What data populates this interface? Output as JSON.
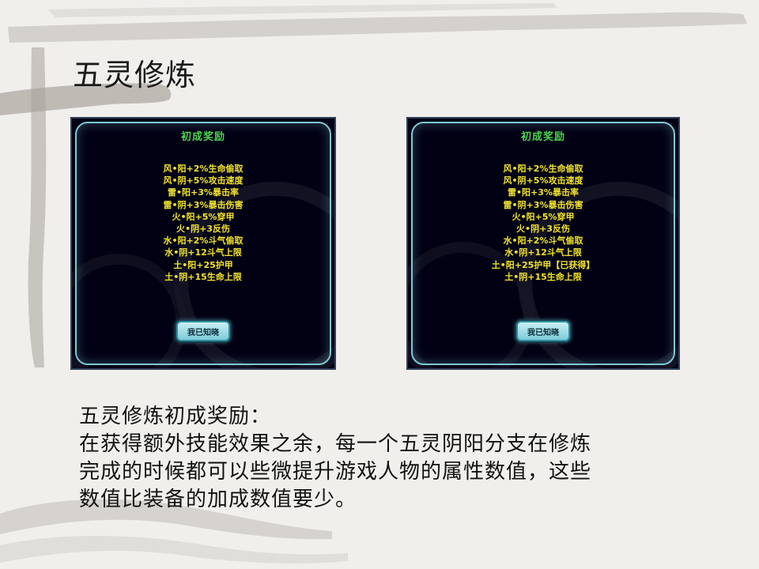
{
  "slide": {
    "title": "五灵修炼"
  },
  "panels": [
    {
      "header": "初成奖励",
      "items": [
        "风•阳+2%生命偷取",
        "风•阴+5%攻击速度",
        "雷•阳+3%暴击率",
        "雷•阴+3%暴击伤害",
        "火•阳+5%穿甲",
        "火•阴+3反伤",
        "水•阳+2%斗气偷取",
        "水•阴+12斗气上限",
        "土•阳+25护甲",
        "土•阴+15生命上限"
      ],
      "button": "我已知晓"
    },
    {
      "header": "初成奖励",
      "items": [
        "风•阳+2%生命偷取",
        "风•阴+5%攻击速度",
        "雷•阳+3%暴击率",
        "雷•阴+3%暴击伤害",
        "火•阳+5%穿甲",
        "火•阴+3反伤",
        "水•阳+2%斗气偷取",
        "水•阴+12斗气上限",
        "土•阳+25护甲【已获得】",
        "土•阴+15生命上限"
      ],
      "button": "我已知晓"
    }
  ],
  "description": {
    "lines": [
      "五灵修炼初成奖励：",
      "在获得额外技能效果之余，每一个五灵阴阳分支在修炼",
      "完成的时候都可以些微提升游戏人物的属性数值，这些",
      "数值比装备的加成数值要少。"
    ]
  },
  "colors": {
    "background": "#f1efec",
    "panel_bg": "#020114",
    "header_green": "#4fd34f",
    "item_yellow": "#f2e42a",
    "button_cyan": "#7ccbd8"
  }
}
